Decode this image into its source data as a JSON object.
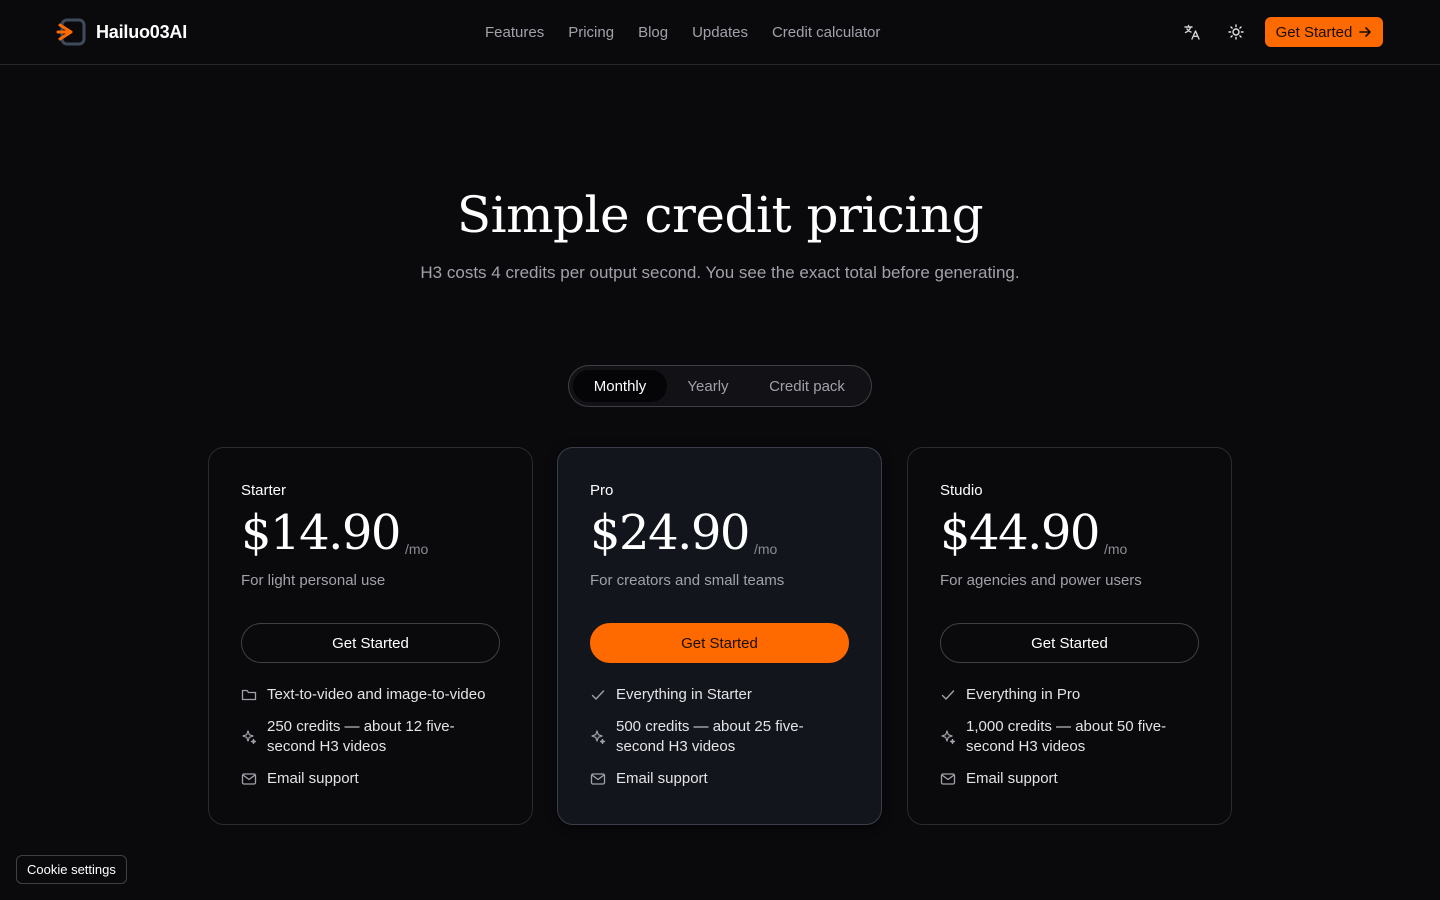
{
  "brand": {
    "name": "Hailuo03AI",
    "logo_icon": "play-logo-icon"
  },
  "nav": [
    "Features",
    "Pricing",
    "Blog",
    "Updates",
    "Credit calculator"
  ],
  "header": {
    "translate_icon": "translate-icon",
    "theme_icon": "sun-icon",
    "cta_label": "Get Started"
  },
  "hero": {
    "title": "Simple credit pricing",
    "subtitle": "H3 costs 4 credits per output second. You see the exact total before generating."
  },
  "billing_toggle": {
    "options": [
      "Monthly",
      "Yearly",
      "Credit pack"
    ],
    "selected": "Monthly"
  },
  "plans": [
    {
      "name": "Starter",
      "price": "$14.90",
      "period": "/mo",
      "description": "For light personal use",
      "button": "Get Started",
      "features": [
        {
          "icon": "folder-icon",
          "text": "Text-to-video and image-to-video"
        },
        {
          "icon": "sparkle-icon",
          "text": "250 credits — about 12 five-second H3 videos"
        },
        {
          "icon": "mail-icon",
          "text": "Email support"
        }
      ]
    },
    {
      "name": "Pro",
      "price": "$24.90",
      "period": "/mo",
      "description": "For creators and small teams",
      "button": "Get Started",
      "features": [
        {
          "icon": "check-icon",
          "text": "Everything in Starter"
        },
        {
          "icon": "sparkle-icon",
          "text": "500 credits — about 25 five-second H3 videos"
        },
        {
          "icon": "mail-icon",
          "text": "Email support"
        }
      ]
    },
    {
      "name": "Studio",
      "price": "$44.90",
      "period": "/mo",
      "description": "For agencies and power users",
      "button": "Get Started",
      "features": [
        {
          "icon": "check-icon",
          "text": "Everything in Pro"
        },
        {
          "icon": "sparkle-icon",
          "text": "1,000 credits — about 50 five-second H3 videos"
        },
        {
          "icon": "mail-icon",
          "text": "Email support"
        }
      ]
    }
  ],
  "cookie": {
    "label": "Cookie settings"
  },
  "colors": {
    "accent": "#ff6a00",
    "background": "#0a0a0d",
    "featured_card": "#12151c"
  }
}
